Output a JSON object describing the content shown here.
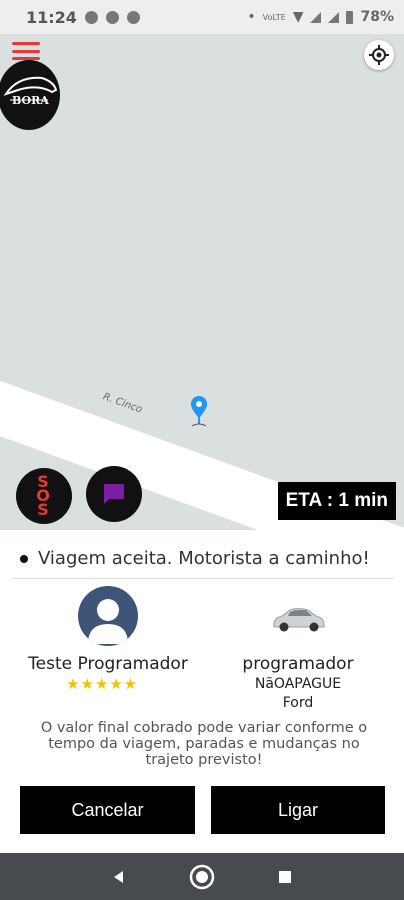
{
  "status_bar": {
    "time": "11:24",
    "battery": "78%"
  },
  "map": {
    "street_name": "R. Cinco"
  },
  "logo": {
    "text": "BORA"
  },
  "map_controls": {
    "sos_label": "SOS",
    "eta_label": "ETA : 1 min"
  },
  "trip": {
    "status_message": "Viagem aceita. Motorista a caminho!",
    "driver_name": "Teste Programador",
    "rating": "★★★★★",
    "rating_value": 5,
    "vehicle_label": "programador",
    "vehicle_plate": "NãOAPAGUE",
    "vehicle_model": "Ford",
    "notice": "O valor final cobrado pode variar conforme o tempo da viagem, paradas e mudanças no trajeto previsto!"
  },
  "actions": {
    "cancel_label": "Cancelar",
    "call_label": "Ligar"
  },
  "colors": {
    "accent_red": "#e53935",
    "chat_purple": "#7b1fa2",
    "pin_blue": "#2196f3",
    "star_yellow": "#f2c200"
  },
  "icons": {
    "menu": "hamburger-menu-icon",
    "locate": "my-location-icon",
    "chat": "chat-icon",
    "pin": "map-pin-icon",
    "back": "back-icon",
    "home": "home-icon",
    "recents": "recents-icon"
  }
}
